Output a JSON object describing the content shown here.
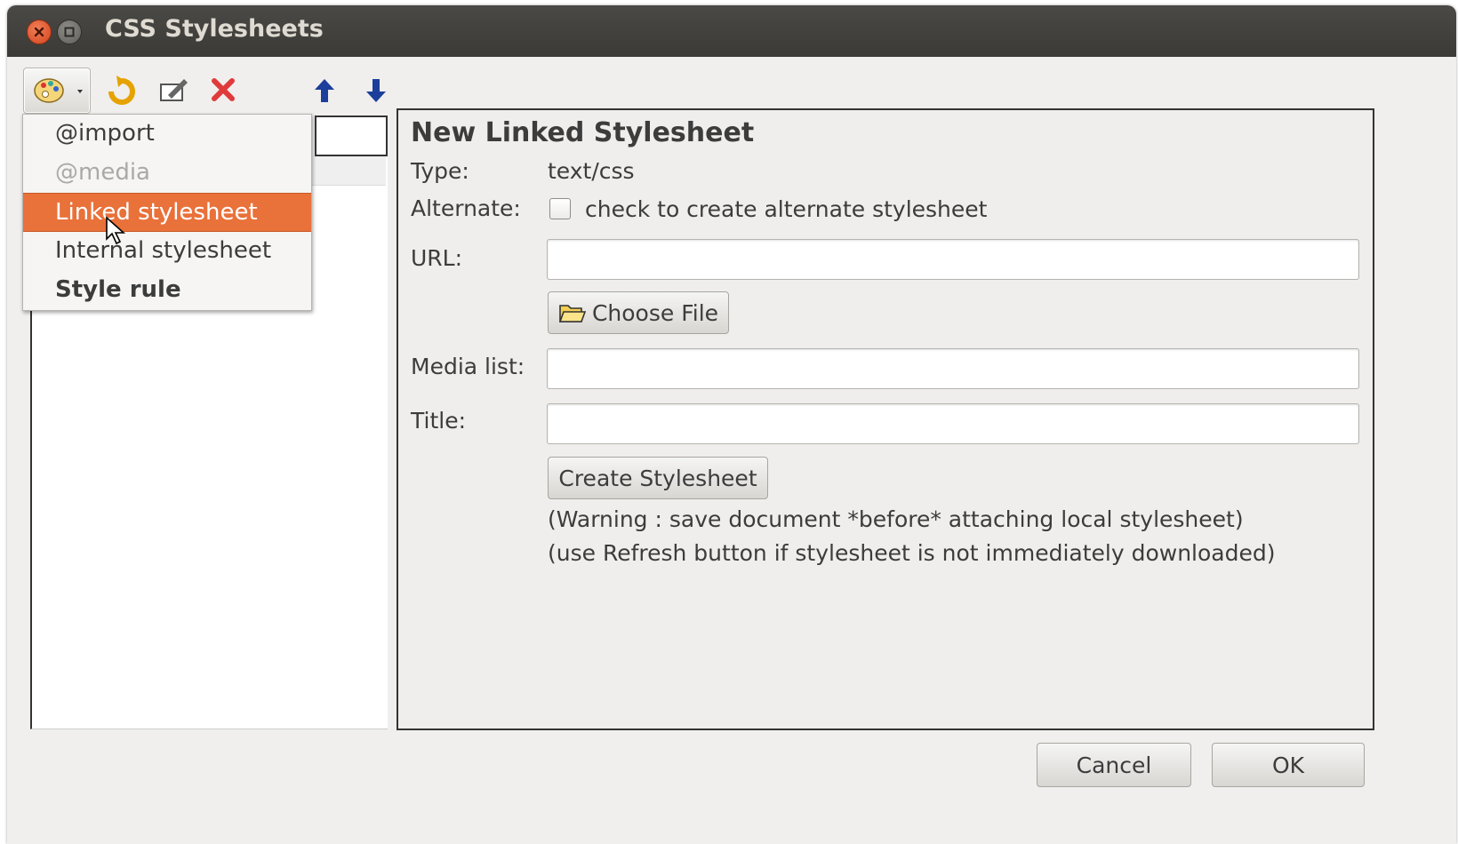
{
  "window": {
    "title": "CSS Stylesheets"
  },
  "toolbar": {
    "icons": [
      "palette-icon",
      "refresh-icon",
      "edit-icon",
      "delete-icon",
      "arrow-up-icon",
      "arrow-down-icon"
    ]
  },
  "menu": {
    "items": [
      {
        "label": "@import",
        "state": "normal"
      },
      {
        "label": "@media",
        "state": "disabled"
      },
      {
        "label": "Linked stylesheet",
        "state": "highlighted"
      },
      {
        "label": "Internal stylesheet",
        "state": "normal"
      },
      {
        "label": "Style rule",
        "state": "bold"
      }
    ]
  },
  "panel": {
    "title": "New Linked Stylesheet",
    "type_label": "Type:",
    "type_value": "text/css",
    "alternate_label": "Alternate:",
    "alternate_checkbox_label": "check to create alternate stylesheet",
    "alternate_checked": false,
    "url_label": "URL:",
    "url_value": "",
    "choose_file_label": "Choose File",
    "media_label": "Media list:",
    "media_value": "",
    "title_label": "Title:",
    "title_value": "",
    "create_label": "Create Stylesheet",
    "warning1": "(Warning : save document *before* attaching local stylesheet)",
    "warning2": "(use Refresh button if stylesheet is not immediately downloaded)"
  },
  "footer": {
    "cancel_label": "Cancel",
    "ok_label": "OK"
  },
  "colors": {
    "highlight": "#e9713a",
    "titlebar": "#3c3b37",
    "close": "#df4a1e"
  }
}
